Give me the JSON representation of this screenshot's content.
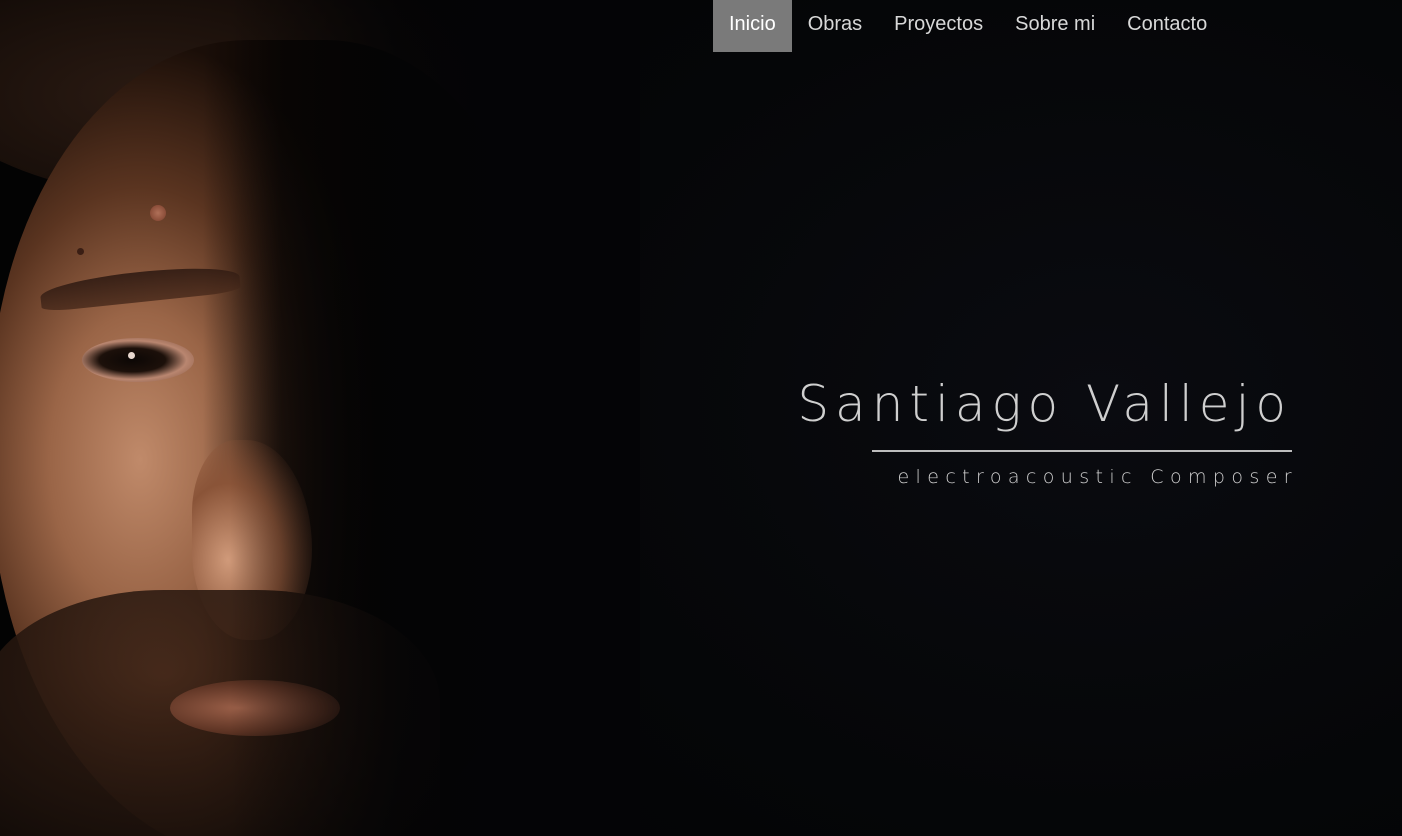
{
  "nav": {
    "items": [
      {
        "label": "Inicio",
        "active": true
      },
      {
        "label": "Obras",
        "active": false
      },
      {
        "label": "Proyectos",
        "active": false
      },
      {
        "label": "Sobre mi",
        "active": false
      },
      {
        "label": "Contacto",
        "active": false
      }
    ],
    "active_bg": "#7a7a7a",
    "text_color": "#d8d8d8"
  },
  "hero": {
    "name": "Santiago Vallejo",
    "subtitle": "electroacoustic Composer",
    "background_color": "#050505",
    "text_color": "#cfcfcf"
  }
}
